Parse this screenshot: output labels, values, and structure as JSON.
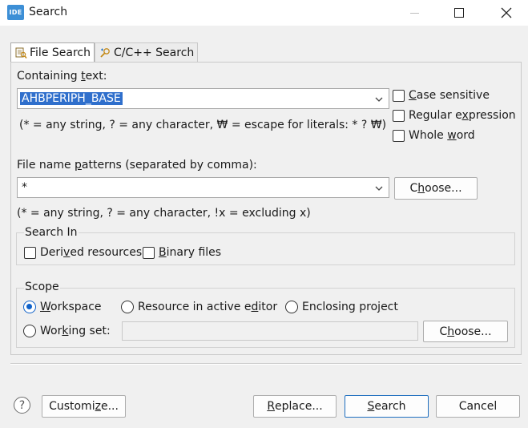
{
  "window": {
    "app_icon_text": "IDE",
    "title": "Search"
  },
  "tabs": [
    {
      "label": "File Search",
      "icon": "file-search-icon",
      "active": true
    },
    {
      "label": "C/C++ Search",
      "icon": "cpp-search-icon",
      "active": false
    }
  ],
  "containing_text": {
    "label_pre": "Containing ",
    "label_mn": "t",
    "label_post": "ext:",
    "value": "AHBPERIPH_BASE",
    "hint": "(* = any string, ? = any character, ₩ = escape for literals: * ? ₩)"
  },
  "options": {
    "case_sensitive": {
      "pre": "",
      "mn": "C",
      "post": "ase sensitive",
      "checked": false
    },
    "regular_expression": {
      "pre": "Regular e",
      "mn": "x",
      "post": "pression",
      "checked": false
    },
    "whole_word": {
      "pre": "Whole ",
      "mn": "w",
      "post": "ord",
      "checked": false
    }
  },
  "file_patterns": {
    "label_pre": "File name ",
    "label_mn": "p",
    "label_post": "atterns (separated by comma):",
    "value": "*",
    "hint": "(* = any string, ? = any character, !x = excluding x)",
    "choose_pre": "C",
    "choose_mn": "h",
    "choose_post": "oose..."
  },
  "search_in": {
    "legend": "Search In",
    "derived": {
      "pre": "Deri",
      "mn": "v",
      "post": "ed resources",
      "checked": false
    },
    "binary": {
      "pre": "",
      "mn": "B",
      "post": "inary files",
      "checked": false
    }
  },
  "scope": {
    "legend": "Scope",
    "workspace": {
      "pre": "",
      "mn": "W",
      "post": "orkspace",
      "selected": true
    },
    "active_editor": {
      "pre": "Resource in active e",
      "mn": "d",
      "post": "itor",
      "selected": false
    },
    "enclosing": {
      "pre": "Enclosing pro",
      "mn": "j",
      "post": "ect",
      "selected": false
    },
    "working_set": {
      "pre": "Wor",
      "mn": "k",
      "post": "ing set:",
      "selected": false
    },
    "working_set_value": "",
    "choose_pre": "C",
    "choose_mn": "h",
    "choose_post": "oose..."
  },
  "footer": {
    "help_glyph": "?",
    "customize_pre": "Customi",
    "customize_mn": "z",
    "customize_post": "e...",
    "replace_pre": "",
    "replace_mn": "R",
    "replace_post": "eplace...",
    "search_pre": "",
    "search_mn": "S",
    "search_post": "earch",
    "cancel": "Cancel"
  },
  "colors": {
    "accent": "#1062c9",
    "selection": "#2f6fcc",
    "default_button_border": "#1f6fbf"
  }
}
